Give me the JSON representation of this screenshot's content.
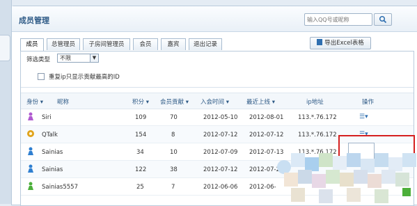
{
  "panel": {
    "title": "成员管理",
    "search": {
      "placeholder": "输入QQ号或昵称"
    },
    "export_label": "导出Excel表格"
  },
  "tabs": [
    {
      "label": "成员",
      "active": true
    },
    {
      "label": "总管理员",
      "active": false
    },
    {
      "label": "子房间管理员",
      "active": false
    },
    {
      "label": "会员",
      "active": false
    },
    {
      "label": "嘉宾",
      "active": false
    },
    {
      "label": "退出记录",
      "active": false
    }
  ],
  "filter": {
    "label": "筛选类型",
    "value": "不限"
  },
  "checkbox": {
    "label": "重复ip只显示贡献最高的ID",
    "checked": false
  },
  "table": {
    "columns": [
      "身份",
      "昵称",
      "积分",
      "会员贡献",
      "入会时间",
      "最近上线",
      "ip地址",
      "操作"
    ],
    "rows": [
      {
        "icon": "purple-member-icon",
        "nick": "Siri",
        "points": "109",
        "contrib": "70",
        "joined": "2012-05-10",
        "last": "2012-08-01",
        "ip": "113.*.76.172"
      },
      {
        "icon": "gold-admin-icon",
        "nick": "QTalk",
        "points": "154",
        "contrib": "8",
        "joined": "2012-07-12",
        "last": "2012-07-12",
        "ip": "113.*.76.172"
      },
      {
        "icon": "blue-member-icon",
        "nick": "Sainias",
        "points": "34",
        "contrib": "10",
        "joined": "2012-07-09",
        "last": "2012-07-13",
        "ip": "113.*.76.172"
      },
      {
        "icon": "blue-member-icon",
        "nick": "Sainias",
        "points": "122",
        "contrib": "38",
        "joined": "2012-07-12",
        "last": "2012-07-27",
        "ip": ""
      },
      {
        "icon": "green-member-icon",
        "nick": "Sainias5557",
        "points": "25",
        "contrib": "7",
        "joined": "2012-06-06",
        "last": "2012-06-",
        "ip": ""
      }
    ]
  },
  "colors": {
    "purple": "#b05ad0",
    "gold": "#e0a21a",
    "blue": "#2f7fd0",
    "green": "#4caf3a",
    "highlight": "#d51f1f"
  }
}
